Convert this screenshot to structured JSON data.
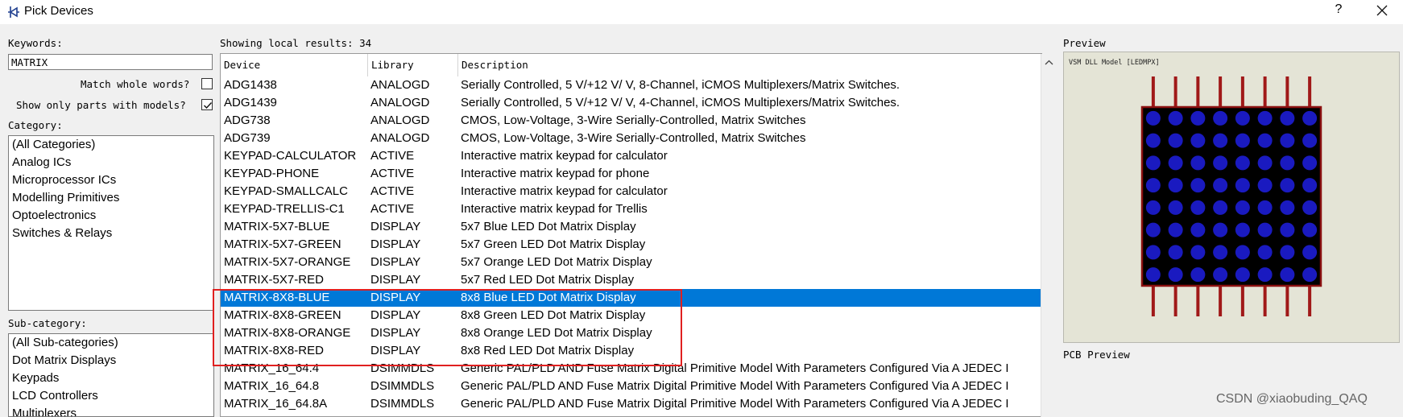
{
  "window": {
    "title": "Pick Devices",
    "help": "?"
  },
  "search": {
    "keywords_label": "Keywords:",
    "keywords_value": "MATRIX",
    "match_whole_words": "Match whole words?",
    "show_only_models": "Show only parts with models?",
    "match_whole_checked": false,
    "show_only_checked": true
  },
  "category": {
    "label": "Category:",
    "items": [
      "(All Categories)",
      "Analog ICs",
      "Microprocessor ICs",
      "Modelling Primitives",
      "Optoelectronics",
      "Switches & Relays"
    ]
  },
  "subcategory": {
    "label": "Sub-category:",
    "items": [
      "(All Sub-categories)",
      "Dot Matrix Displays",
      "Keypads",
      "LCD Controllers",
      "Multiplexers"
    ]
  },
  "results": {
    "summary": "Showing local results: 34",
    "columns": [
      "Device",
      "Library",
      "Description"
    ],
    "selected_index": 12,
    "rows": [
      [
        "ADG1438",
        "ANALOGD",
        "Serially Controlled, 5 V/+12 V/ V, 8-Channel, iCMOS Multiplexers/Matrix Switches."
      ],
      [
        "ADG1439",
        "ANALOGD",
        "Serially Controlled, 5 V/+12 V/ V, 4-Channel, iCMOS Multiplexers/Matrix Switches."
      ],
      [
        "ADG738",
        "ANALOGD",
        "CMOS, Low-Voltage, 3-Wire Serially-Controlled, Matrix Switches"
      ],
      [
        "ADG739",
        "ANALOGD",
        "CMOS, Low-Voltage, 3-Wire Serially-Controlled, Matrix Switches"
      ],
      [
        "KEYPAD-CALCULATOR",
        "ACTIVE",
        "Interactive matrix keypad for calculator"
      ],
      [
        "KEYPAD-PHONE",
        "ACTIVE",
        "Interactive matrix keypad for phone"
      ],
      [
        "KEYPAD-SMALLCALC",
        "ACTIVE",
        "Interactive matrix keypad for calculator"
      ],
      [
        "KEYPAD-TRELLIS-C1",
        "ACTIVE",
        "Interactive matrix keypad for Trellis"
      ],
      [
        "MATRIX-5X7-BLUE",
        "DISPLAY",
        "5x7 Blue LED Dot Matrix Display"
      ],
      [
        "MATRIX-5X7-GREEN",
        "DISPLAY",
        "5x7 Green LED Dot Matrix Display"
      ],
      [
        "MATRIX-5X7-ORANGE",
        "DISPLAY",
        "5x7 Orange LED Dot Matrix Display"
      ],
      [
        "MATRIX-5X7-RED",
        "DISPLAY",
        "5x7 Red LED Dot Matrix Display"
      ],
      [
        "MATRIX-8X8-BLUE",
        "DISPLAY",
        "8x8 Blue LED Dot Matrix Display"
      ],
      [
        "MATRIX-8X8-GREEN",
        "DISPLAY",
        "8x8 Green LED Dot Matrix Display"
      ],
      [
        "MATRIX-8X8-ORANGE",
        "DISPLAY",
        "8x8 Orange LED Dot Matrix Display"
      ],
      [
        "MATRIX-8X8-RED",
        "DISPLAY",
        "8x8 Red LED Dot Matrix Display"
      ],
      [
        "MATRIX_16_64.4",
        "DSIMMDLS",
        "Generic PAL/PLD AND Fuse Matrix Digital Primitive Model With Parameters Configured Via A JEDEC I"
      ],
      [
        "MATRIX_16_64.8",
        "DSIMMDLS",
        "Generic PAL/PLD AND Fuse Matrix Digital Primitive Model With Parameters Configured Via A JEDEC I"
      ],
      [
        "MATRIX_16_64.8A",
        "DSIMMDLS",
        "Generic PAL/PLD AND Fuse Matrix Digital Primitive Model With Parameters Configured Via A JEDEC I"
      ]
    ]
  },
  "preview": {
    "label": "Preview",
    "model_text": "VSM DLL Model [LEDMPX]",
    "pcb_label": "PCB Preview"
  },
  "watermark": "CSDN @xiaobuding_QAQ",
  "colors": {
    "selection": "#0078d7",
    "highlight_box": "#e02020",
    "led_dot": "#1a1ac0",
    "led_frame": "#8b1010",
    "led_pin": "#a01818"
  }
}
